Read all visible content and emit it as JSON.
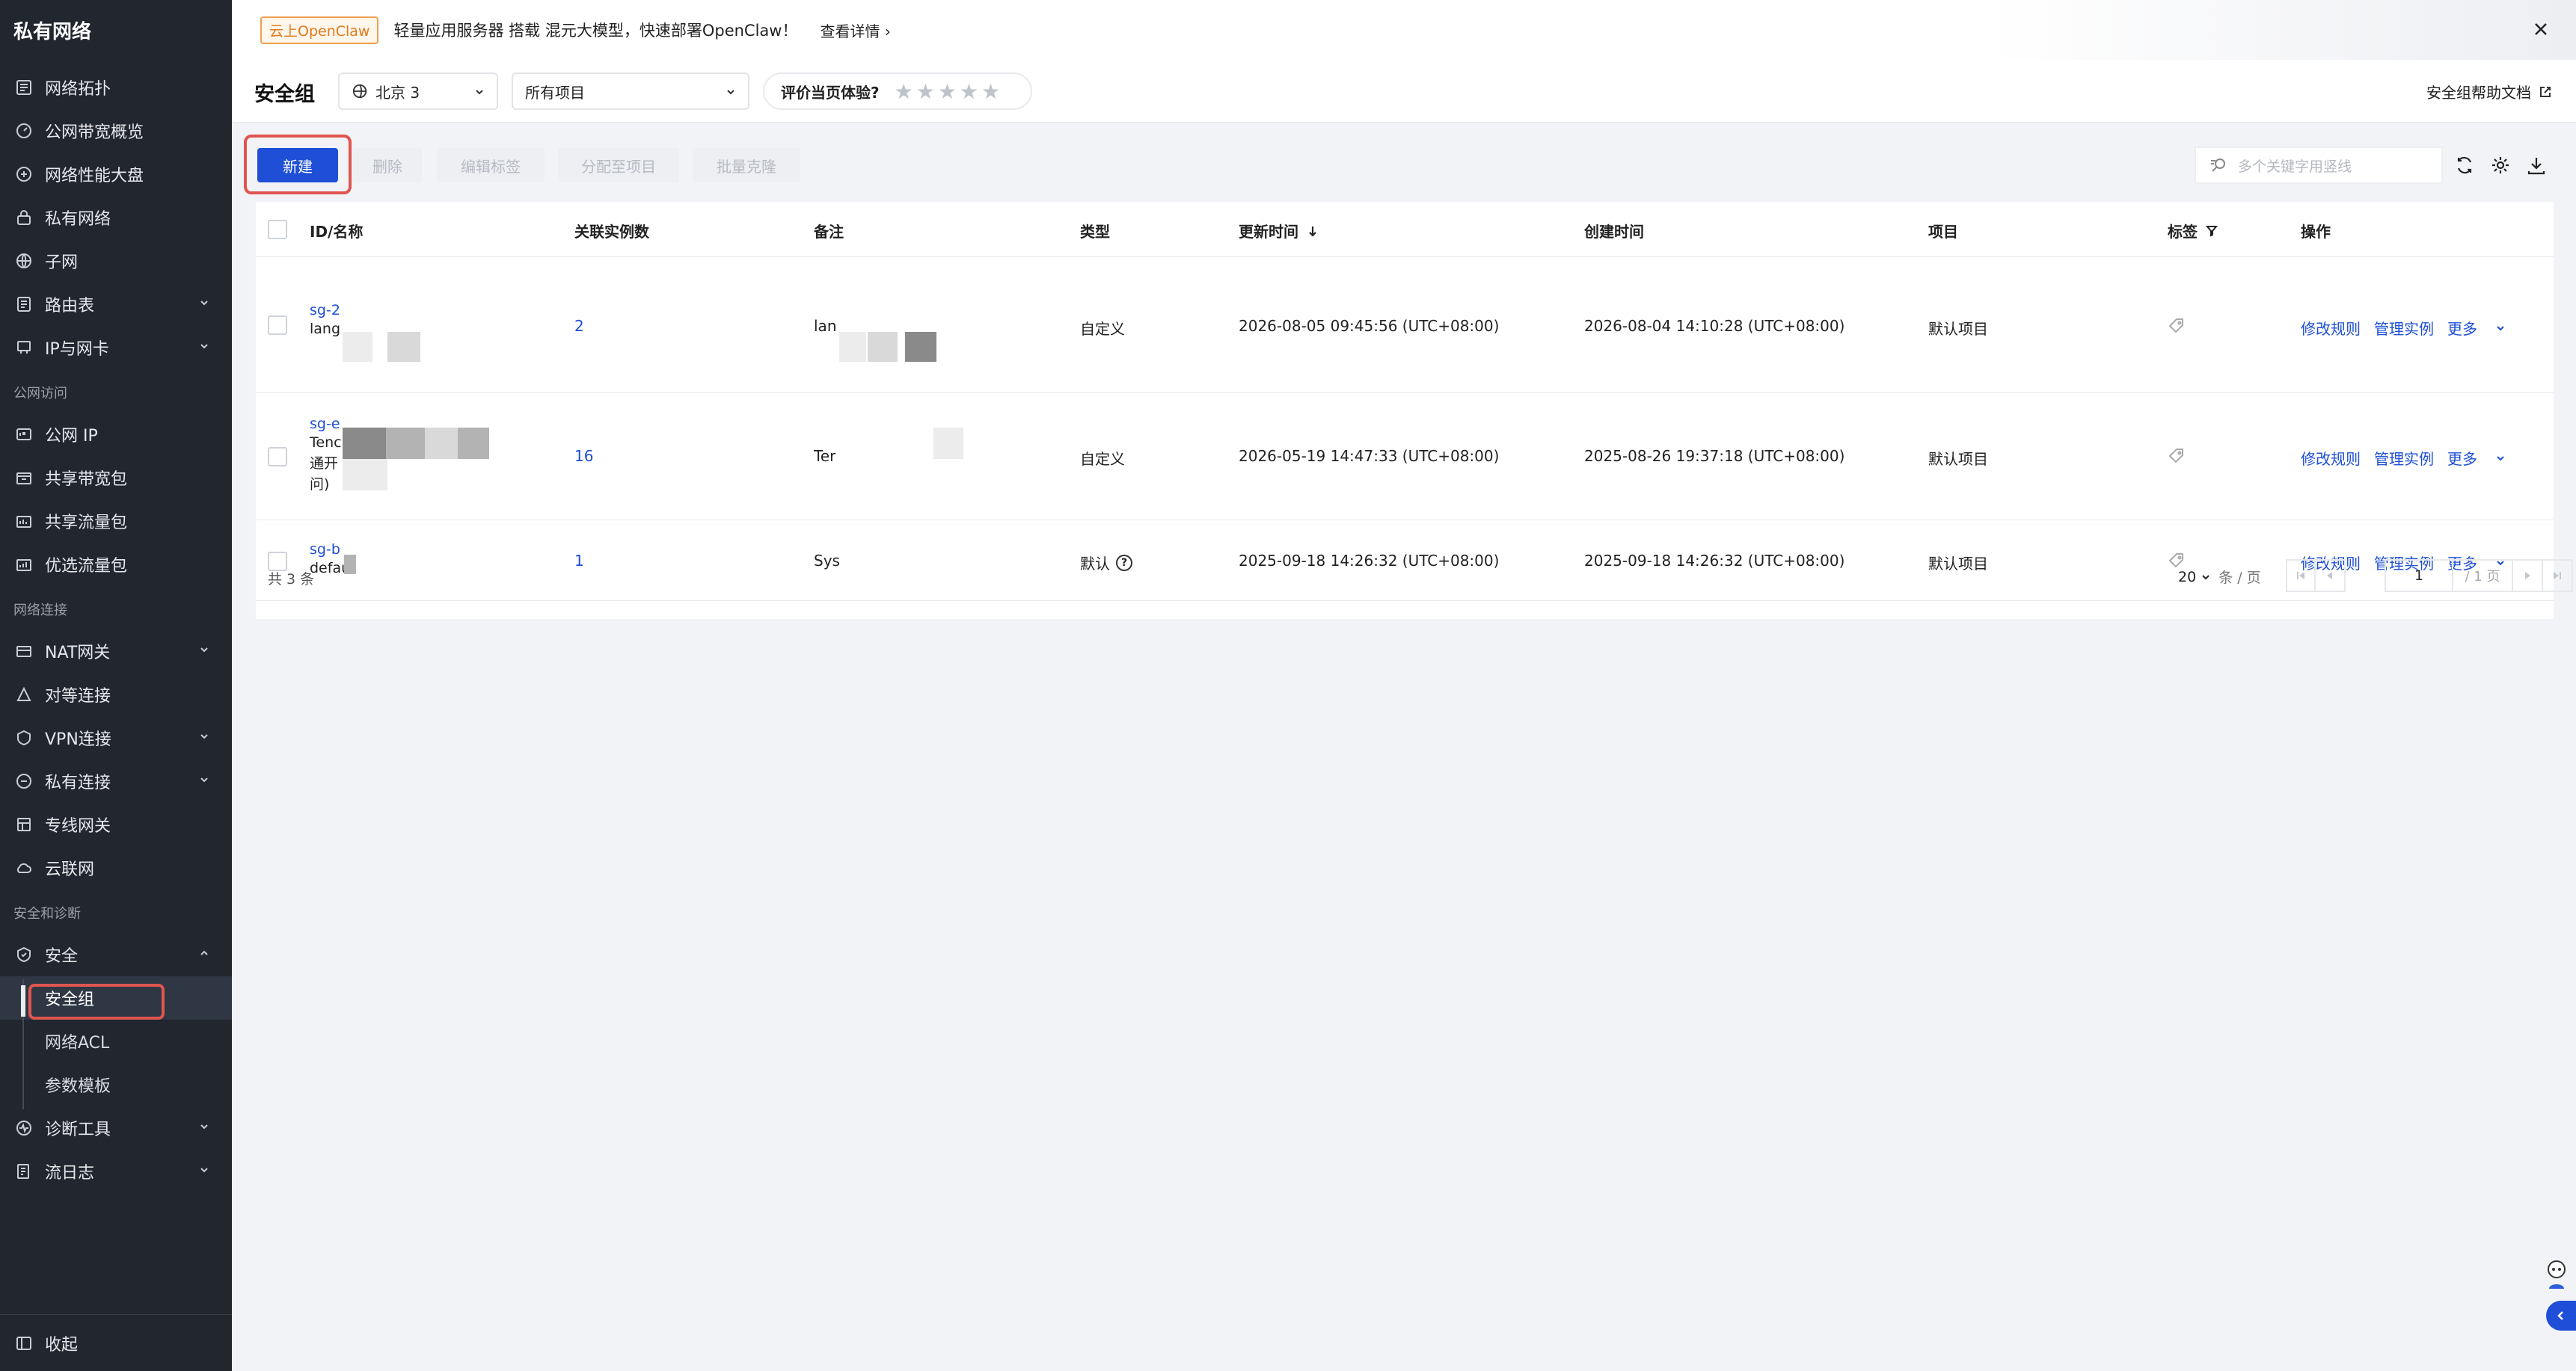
{
  "sidebar": {
    "title": "私有网络",
    "items": [
      {
        "label": "网络拓扑"
      },
      {
        "label": "公网带宽概览"
      },
      {
        "label": "网络性能大盘"
      },
      {
        "label": "私有网络"
      },
      {
        "label": "子网"
      },
      {
        "label": "路由表"
      },
      {
        "label": "IP与网卡"
      }
    ],
    "group_public": "公网访问",
    "public_items": [
      {
        "label": "公网 IP"
      },
      {
        "label": "共享带宽包"
      },
      {
        "label": "共享流量包"
      },
      {
        "label": "优选流量包"
      }
    ],
    "group_connect": "网络连接",
    "connect_items": [
      {
        "label": "NAT网关"
      },
      {
        "label": "对等连接"
      },
      {
        "label": "VPN连接"
      },
      {
        "label": "私有连接"
      },
      {
        "label": "专线网关"
      },
      {
        "label": "云联网"
      }
    ],
    "group_security": "安全和诊断",
    "security": {
      "label": "安全"
    },
    "security_sub": [
      {
        "label": "安全组"
      },
      {
        "label": "网络ACL"
      },
      {
        "label": "参数模板"
      }
    ],
    "diag": {
      "label": "诊断工具"
    },
    "flowlog": {
      "label": "流日志"
    },
    "collapse": "收起"
  },
  "banner": {
    "tag": "云上OpenClaw",
    "text": "轻量应用服务器 搭载 混元大模型，快速部署OpenClaw！",
    "link": "查看详情"
  },
  "header": {
    "title": "安全组",
    "region": "北京 3",
    "project": "所有项目",
    "rating_label": "评价当页体验?",
    "stars": "★★★★★",
    "help": "安全组帮助文档"
  },
  "toolbar": {
    "new": "新建",
    "delete": "删除",
    "edit_tags": "编辑标签",
    "assign_project": "分配至项目",
    "batch_clone": "批量克隆",
    "search_placeholder": "多个关键字用竖线"
  },
  "table": {
    "columns": {
      "id_name": "ID/名称",
      "instances": "关联实例数",
      "remark": "备注",
      "type": "类型",
      "updated": "更新时间",
      "created": "创建时间",
      "project": "项目",
      "tags": "标签",
      "ops": "操作"
    },
    "rows": [
      {
        "id": "sg-2",
        "name": "lang",
        "instances": "2",
        "remark": "lan",
        "type": "自定义",
        "updated": "2026-08-05 09:45:56 (UTC+08:00)",
        "created": "2026-08-04 14:10:28 (UTC+08:00)",
        "project": "默认项目"
      },
      {
        "id": "sg-e",
        "name1": "Tenc",
        "name2": "通开",
        "name3": "问)",
        "instances": "16",
        "remark": "Ter",
        "type": "自定义",
        "updated": "2026-05-19 14:47:33 (UTC+08:00)",
        "created": "2025-08-26 19:37:18 (UTC+08:00)",
        "project": "默认项目"
      },
      {
        "id": "sg-b",
        "name": "defau",
        "instances": "1",
        "remark": "Sys",
        "type": "默认",
        "updated": "2025-09-18 14:26:32 (UTC+08:00)",
        "created": "2025-09-18 14:26:32 (UTC+08:00)",
        "project": "默认项目"
      }
    ],
    "op_edit": "修改规则",
    "op_manage": "管理实例",
    "op_more": "更多",
    "total": "共 3 条",
    "page_size": "20",
    "page_unit": "条 / 页",
    "page_current": "1",
    "page_total": "/ 1 页"
  },
  "colors": {
    "primary": "#1e4fd6",
    "sidebar_bg": "#22262e",
    "highlight": "#e0554f"
  }
}
